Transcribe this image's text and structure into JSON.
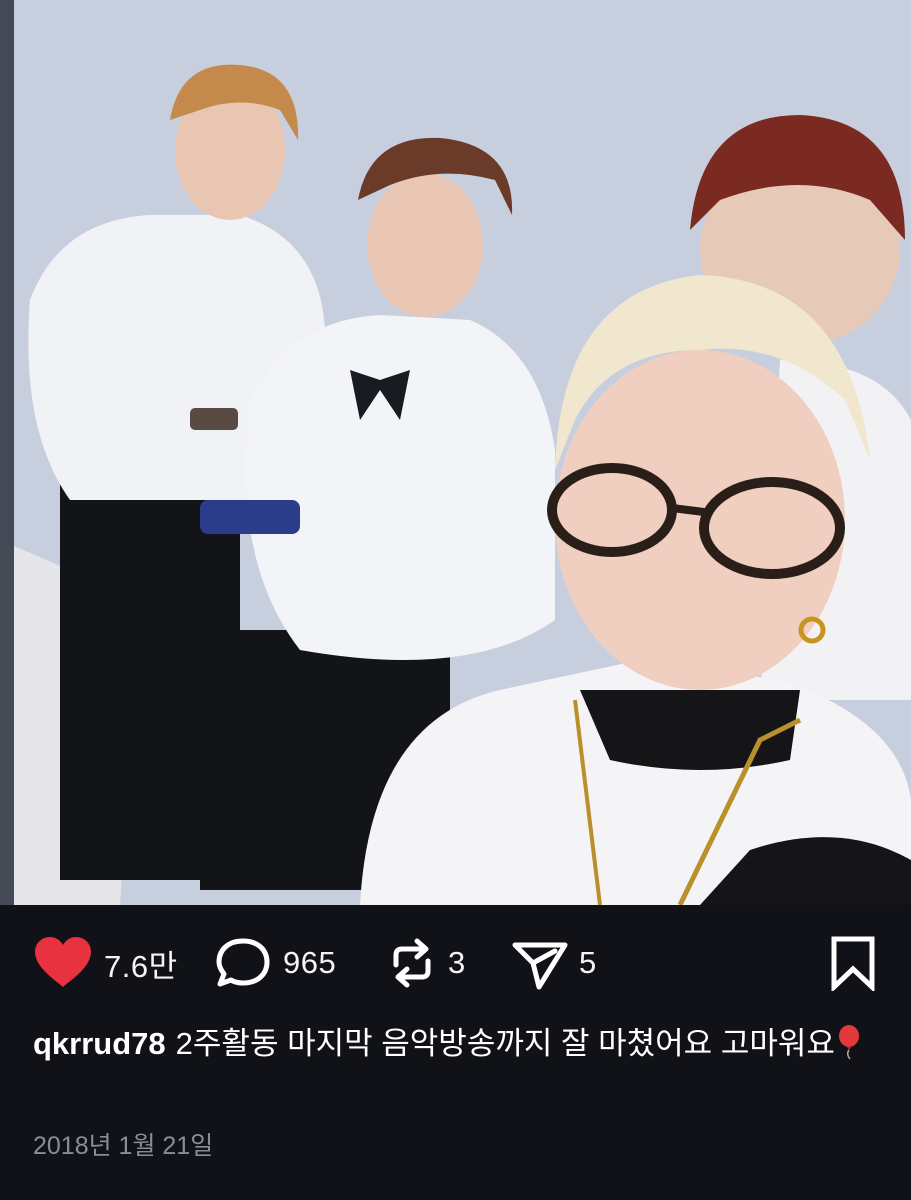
{
  "post": {
    "photo_alt": "Group selfie of four people in white outfits against a light wall",
    "actions": {
      "like_count": "7.6만",
      "comment_count": "965",
      "repost_count": "3",
      "share_count": "5"
    },
    "caption": {
      "username": "qkrrud78",
      "text": "2주활동 마지막 음악방송까지 잘 마쳤어요 고마워요"
    },
    "date": "2018년 1월 21일"
  },
  "icons": {
    "like": "heart-icon",
    "comment": "comment-bubble-icon",
    "repost": "repost-arrows-icon",
    "share": "send-paper-plane-icon",
    "bookmark": "bookmark-icon",
    "emoji": "balloon-emoji-icon"
  },
  "colors": {
    "background": "#101217",
    "heart": "#e8323f",
    "date_text": "#8a8d94",
    "balloon": "#e23a3a"
  }
}
